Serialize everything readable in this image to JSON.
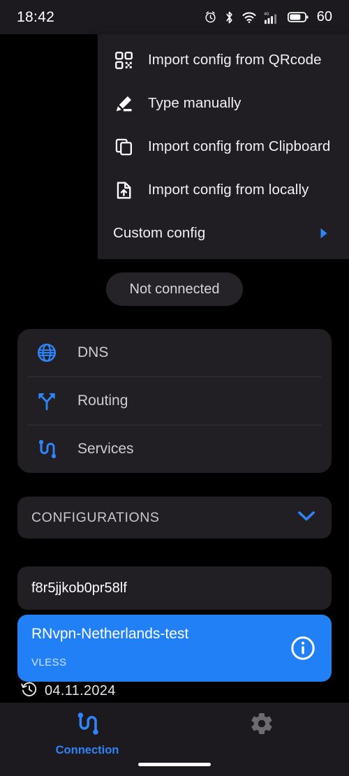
{
  "status_bar": {
    "time": "18:42",
    "battery_level": "60",
    "icons": [
      "alarm-icon",
      "bluetooth-icon",
      "wifi-icon",
      "cellular-signal-icon",
      "battery-icon"
    ]
  },
  "menu": {
    "items": [
      {
        "label": "Import config from QRcode",
        "icon": "qrcode-icon",
        "has_submenu": false
      },
      {
        "label": "Type manually",
        "icon": "pencil-icon",
        "has_submenu": false
      },
      {
        "label": "Import config from Clipboard",
        "icon": "clipboard-copy-icon",
        "has_submenu": false
      },
      {
        "label": "Import config from locally",
        "icon": "file-upload-icon",
        "has_submenu": false
      },
      {
        "label": "Custom config",
        "icon": "none",
        "has_submenu": true
      }
    ],
    "submenu_arrow_icon": "caret-right-icon"
  },
  "connection_status": {
    "label": "Not connected"
  },
  "settings": {
    "items": [
      {
        "label": "DNS",
        "icon": "globe-icon"
      },
      {
        "label": "Routing",
        "icon": "route-branch-icon"
      },
      {
        "label": "Services",
        "icon": "cable-icon"
      }
    ]
  },
  "configurations": {
    "header": "CONFIGURATIONS",
    "expand_icon": "chevron-down-icon",
    "items": [
      {
        "name": "f8r5jjkob0pr58lf",
        "protocol": "",
        "selected": false,
        "info_icon": ""
      },
      {
        "name": "RNvpn-Netherlands-test",
        "protocol": "VLESS",
        "selected": true,
        "info_icon": "info-circle-icon"
      }
    ]
  },
  "history": {
    "icon": "history-clock-icon",
    "date": "04.11.2024"
  },
  "bottom_nav": {
    "tabs": [
      {
        "label": "Connection",
        "icon": "cable-icon",
        "active": true
      },
      {
        "label": "",
        "icon": "gear-icon",
        "active": false
      }
    ]
  },
  "colors": {
    "accent_blue": "#2280f7",
    "nav_active_blue": "#2f84f8",
    "page_background": "#000000",
    "card_background": "#211f24",
    "menu_background": "#201e23",
    "bar_background": "#1c1a1f",
    "inactive_gray": "#6b6b70"
  }
}
